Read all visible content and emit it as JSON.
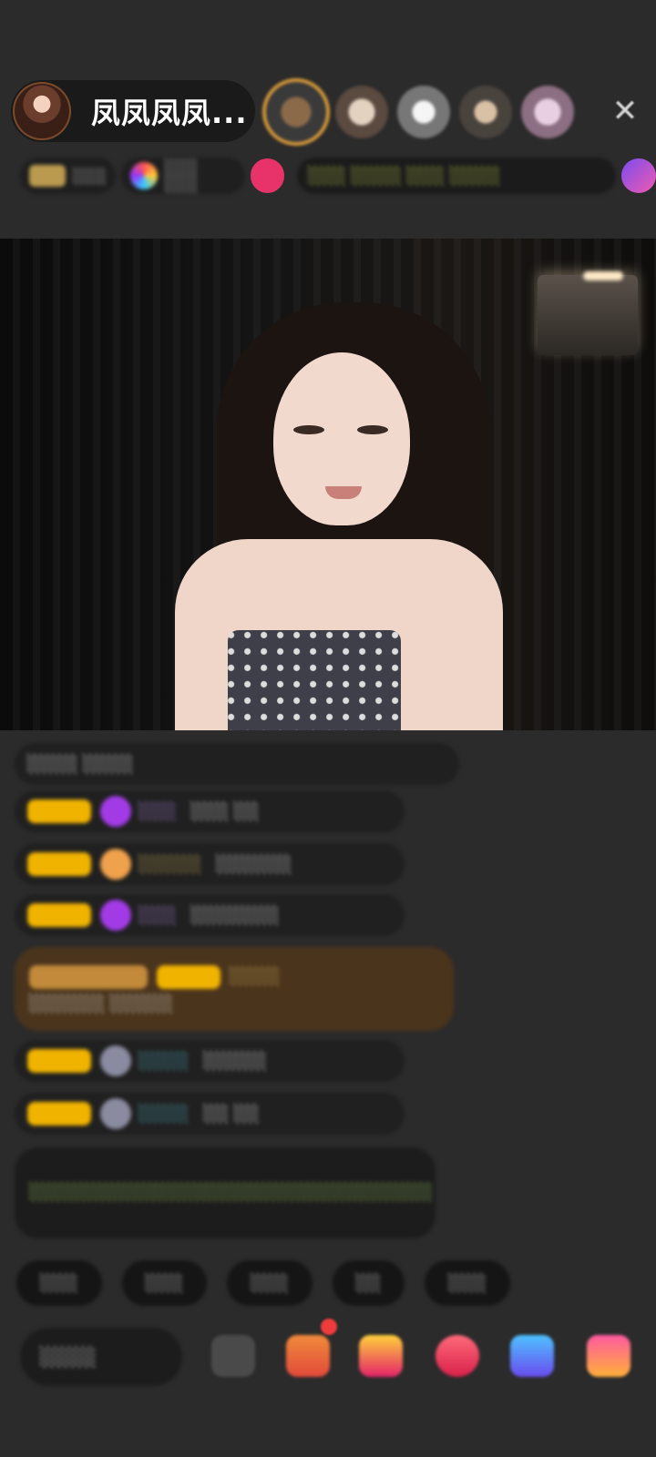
{
  "header": {
    "host_name": "凤凤凤凤...",
    "close_glyph": "✕",
    "info_chips": [
      "░░░",
      "░░░ ░░░"
    ],
    "marquee_text": "░░░ ░░░░ ░░░ ░░░░"
  },
  "chat": {
    "messages": [
      {
        "user": "",
        "text": "░░░░ ░░░░"
      },
      {
        "user": "░░░",
        "text": "░░░ ░░"
      },
      {
        "user": "░░░░░",
        "text": "░░░░░░"
      },
      {
        "user": "░░░",
        "text": "░░░░░░░"
      },
      {
        "user": "░░░░",
        "text": "░░░░░░ ░░░░░"
      },
      {
        "user": "░░░░",
        "text": "░░░░░"
      },
      {
        "user": "░░░░",
        "text": "░░ ░░"
      },
      {
        "user": "",
        "text": "░░░░░░░░░░░░░░░░░░░░░░░░░░░░░░░░"
      }
    ]
  },
  "quick_replies": [
    "░░░",
    "░░░",
    "░░░",
    "░░",
    "░░░"
  ],
  "bottom": {
    "say_placeholder": "░░░░"
  },
  "colors": {
    "background": "#2b2b2b",
    "badge": "#f0b300",
    "system_message": "#9ed05f",
    "highlight_bg": "#4a341c"
  }
}
